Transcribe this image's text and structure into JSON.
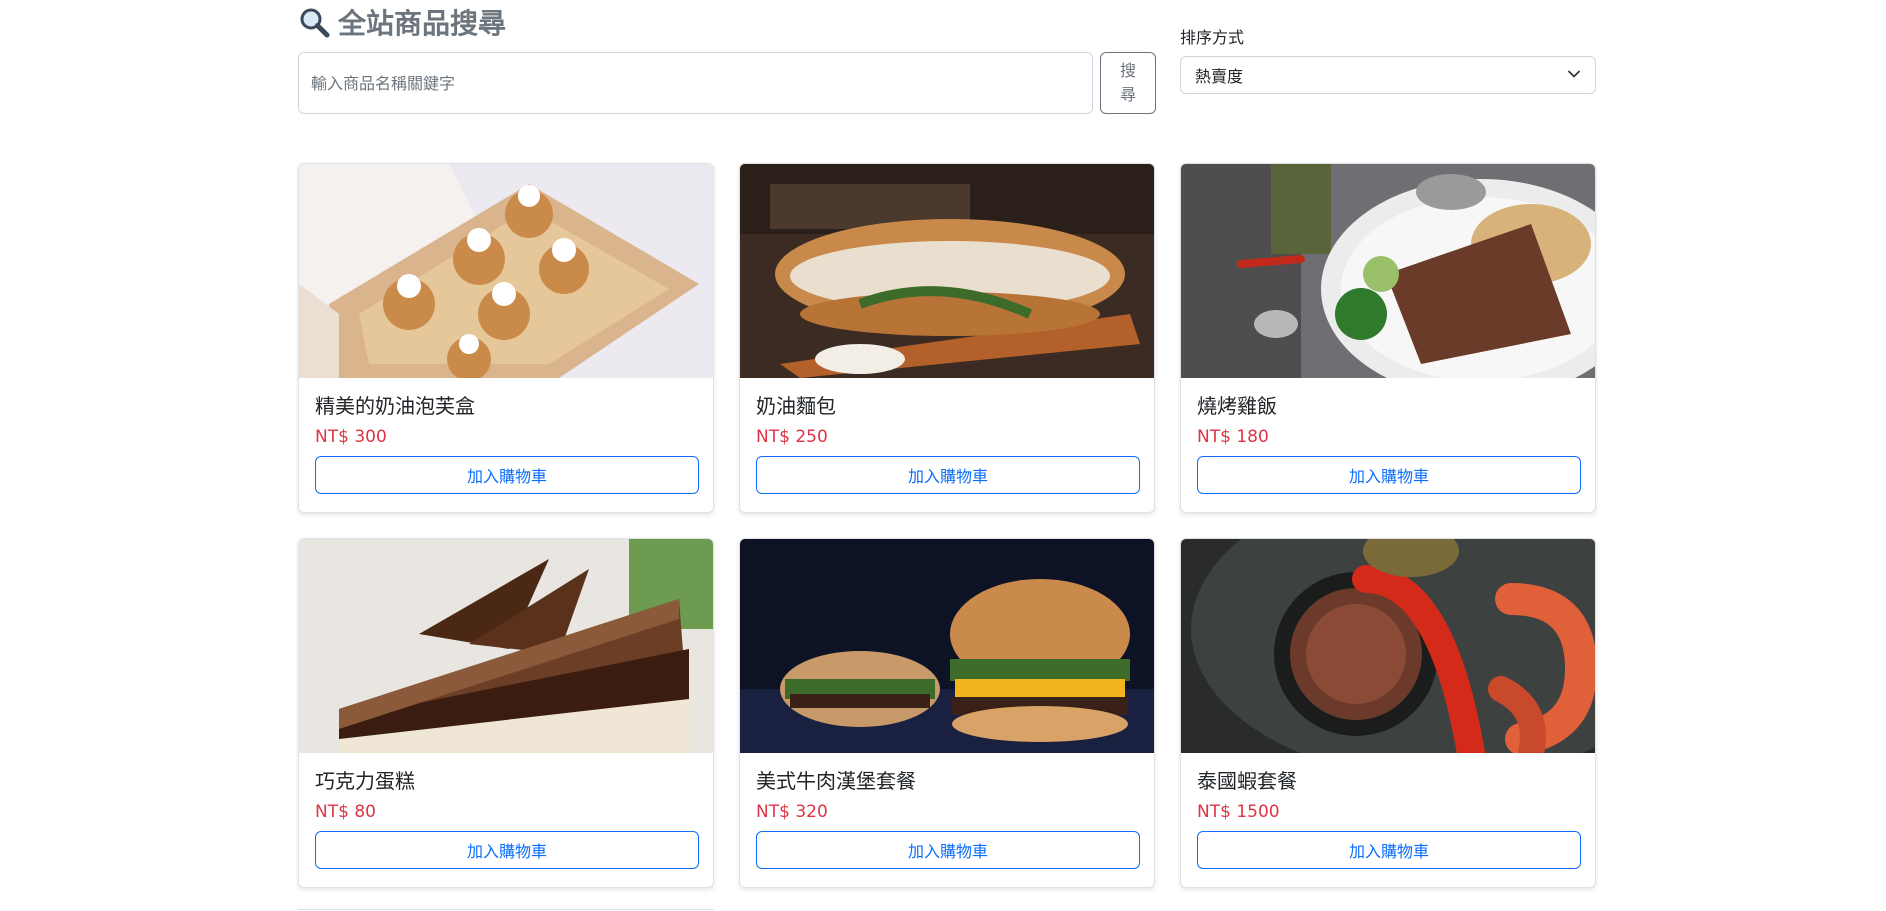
{
  "search": {
    "title": "全站商品搜尋",
    "placeholder": "輸入商品名稱關鍵字",
    "value": "",
    "button_label": "搜尋"
  },
  "sort": {
    "label": "排序方式",
    "selected": "熱賣度"
  },
  "products": [
    {
      "name": "精美的奶油泡芙盒",
      "price": "NT$ 300",
      "button_label": "加入購物車",
      "image": "cream-puff-box-photo"
    },
    {
      "name": "奶油麵包",
      "price": "NT$ 250",
      "button_label": "加入購物車",
      "image": "cream-sandwich-photo"
    },
    {
      "name": "燒烤雞飯",
      "price": "NT$ 180",
      "button_label": "加入購物車",
      "image": "grilled-chicken-rice-photo"
    },
    {
      "name": "巧克力蛋糕",
      "price": "NT$ 80",
      "button_label": "加入購物車",
      "image": "chocolate-cake-photo"
    },
    {
      "name": "美式牛肉漢堡套餐",
      "price": "NT$ 320",
      "button_label": "加入購物車",
      "image": "beef-burger-photo"
    },
    {
      "name": "泰國蝦套餐",
      "price": "NT$ 1500",
      "button_label": "加入購物車",
      "image": "thai-shrimp-photo"
    }
  ],
  "colors": {
    "price": "#dc3545",
    "primary": "#0d6efd",
    "muted": "#6c757d"
  },
  "icons": {
    "search": "magnifier-icon",
    "dropdown": "chevron-down-icon"
  }
}
